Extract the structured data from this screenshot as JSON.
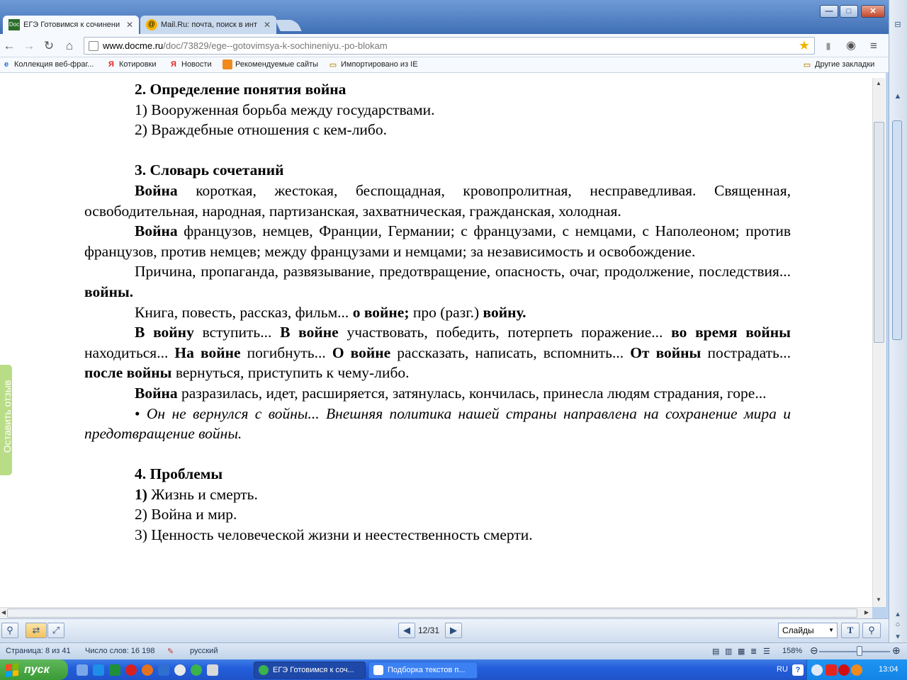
{
  "browser": {
    "tabs": [
      {
        "label": "ЕГЭ Готовимся к сочинени",
        "favicon": "docme-icon"
      },
      {
        "label": "Mail.Ru: почта, поиск в инт",
        "favicon": "mailru-icon"
      }
    ],
    "url_host": "www.docme.ru",
    "url_path": "/doc/73829/ege--gotovimsya-k-sochineniyu.-po-blokam",
    "bookmarks": [
      {
        "label": "Коллекция веб-фраг...",
        "icon": "ie-icon"
      },
      {
        "label": "Котировки",
        "icon": "yandex-icon"
      },
      {
        "label": "Новости",
        "icon": "yandex-icon"
      },
      {
        "label": "Рекомендуемые сайты",
        "icon": "orange-icon"
      },
      {
        "label": "Импортировано из IE",
        "icon": "folder-icon"
      }
    ],
    "other_bookmarks": "Другие закладки"
  },
  "document": {
    "sec2_title": "2. Определение понятия война",
    "sec2_item1": "1) Вооруженная борьба между государствами.",
    "sec2_item2": "2) Враждебные отношения с кем-либо.",
    "sec3_title": "3. Словарь сочетаний",
    "p1_b": "Война",
    "p1_t": " короткая, жестокая, беспощадная, кровопролитная, несправедливая. Священная, освободительная, народная, партизанская, захватническая, гражданская, холодная.",
    "p2_b": "Война",
    "p2_t": " французов, немцев, Франции, Германии; с французами, с немцами, с Наполеоном; против французов, против немцев; между французами и немцами; за независимость и освобождение.",
    "p3_t": "Причина, пропаганда, развязывание, предотвращение, опасность, очаг, продолжение, последствия... ",
    "p3_b": "войны.",
    "p4_t1": "Книга, повесть, рассказ, фильм... ",
    "p4_b1": "о войне;",
    "p4_t2": " про (разг.) ",
    "p4_b2": "войну.",
    "p5_b1": "В войну",
    "p5_t1": " вступить... ",
    "p5_b2": "В войне",
    "p5_t2": " участвовать, победить, потерпеть поражение... ",
    "p5_b3": "во время войны",
    "p5_t3": " находиться... ",
    "p5_b4": "На войне",
    "p5_t4": " погибнуть... ",
    "p5_b5": "О войне",
    "p5_t5": " рассказать, написать, вспомнить... ",
    "p5_b6": "От войны",
    "p5_t6": " пострадать... ",
    "p5_b7": "после войны",
    "p5_t7": " вернуться, приступить к чему-либо.",
    "p6_b": "Война",
    "p6_t": " разразилась, идет, расширяется, затянулась, кончилась, принесла людям страдания, горе...",
    "p7_bullet": "• ",
    "p7_i": "Он не вернулся с войны... Внешняя политика нашей страны направлена на сохранение мира и предотвращение войны.",
    "sec4_title": "4. Проблемы",
    "sec4_item1_num": "1)",
    "sec4_item1_t": " Жизнь и смерть.",
    "sec4_item2": "2) Война и мир.",
    "sec4_item3": "3) Ценность человеческой жизни и неестественность смерти."
  },
  "feedback_tab": "Оставить отзыв",
  "reading_bar": {
    "page_counter": "12/31",
    "view_select": "Слайды"
  },
  "statusbar": {
    "page": "Страница: 8 из 41",
    "words": "Число слов: 16 198",
    "language": "русский",
    "zoom": "158%"
  },
  "taskbar": {
    "start": "пуск",
    "tasks": [
      {
        "label": "ЕГЭ Готовимся к соч...",
        "pressed": true
      },
      {
        "label": "Подборка текстов п...",
        "pressed": false
      }
    ],
    "lang": "RU",
    "clock": "13:04"
  }
}
